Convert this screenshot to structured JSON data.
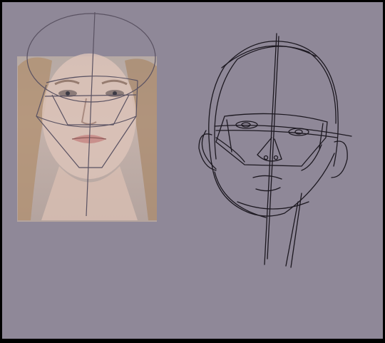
{
  "canvas": {
    "background": "#8f8898",
    "border": "#000000"
  },
  "reference_photo": {
    "description_icon": "portrait-photo-icon",
    "overlay_stroke": "#5a5262"
  },
  "sketch": {
    "stroke": "#1c1820"
  }
}
